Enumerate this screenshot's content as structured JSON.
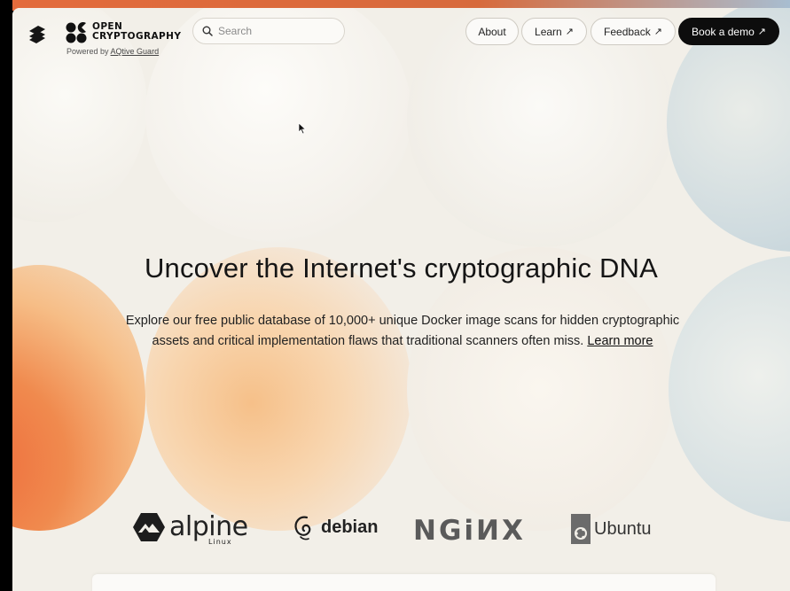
{
  "header": {
    "brand_line1": "OPEN",
    "brand_line2": "CRYPTOGRAPHY",
    "powered_prefix": "Powered by",
    "powered_link": "AQtive Guard",
    "search_placeholder": "Search",
    "nav": {
      "about": "About",
      "learn": "Learn",
      "feedback": "Feedback",
      "demo": "Book a demo"
    },
    "arrow_glyph": "↗"
  },
  "hero": {
    "title": "Uncover the Internet's cryptographic DNA",
    "subtitle": "Explore our free public database of 10,000+ unique Docker image scans for hidden cryptographic assets and critical implementation flaws that traditional scanners often miss.",
    "learn_more": "Learn more"
  },
  "logos": {
    "alpine": "alpine",
    "alpine_sub": "Linux",
    "debian": "debian",
    "nginx": "NGiИX",
    "ubuntu": "Ubuntu"
  },
  "colors": {
    "accent_orange": "#ee6b3b",
    "accent_blue": "#b6c9d3",
    "background": "#f2efe8",
    "button_dark": "#0d0d0d"
  }
}
